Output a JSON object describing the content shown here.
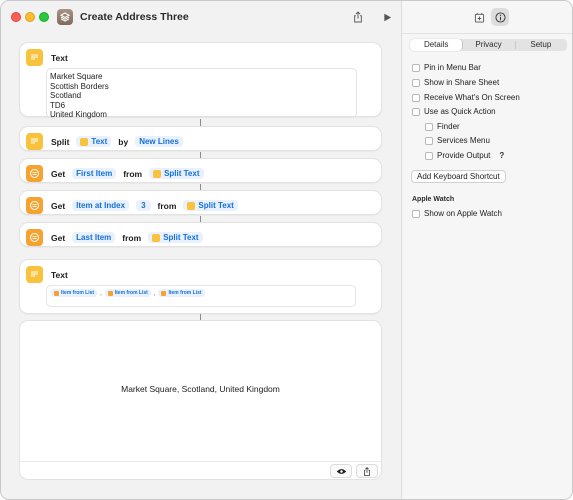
{
  "window": {
    "title": "Create Address Three",
    "app_icon": "layers-icon"
  },
  "toolbar": {
    "share_icon": "share-icon",
    "run_icon": "play-icon"
  },
  "actions": [
    {
      "kind": "text",
      "label": "Text",
      "lines": [
        "Market Square",
        "Scottish Borders",
        "Scotland",
        "TD6",
        "United Kingdom"
      ]
    },
    {
      "kind": "split",
      "label": "Split",
      "input_token": "Text",
      "by_label": "by",
      "separator_token": "New Lines"
    },
    {
      "kind": "get",
      "label": "Get",
      "item_token": "First Item",
      "from_label": "from",
      "source_token": "Split Text"
    },
    {
      "kind": "get",
      "label": "Get",
      "item_token": "Item at Index",
      "index_token": "3",
      "from_label": "from",
      "source_token": "Split Text"
    },
    {
      "kind": "get",
      "label": "Get",
      "item_token": "Last Item",
      "from_label": "from",
      "source_token": "Split Text"
    },
    {
      "kind": "text",
      "label": "Text",
      "variables": [
        "Item from List",
        "Item from List",
        "Item from List"
      ],
      "separator": ","
    }
  ],
  "result": {
    "text": "Market Square, Scotland, United Kingdom",
    "eye_icon": "eye-icon",
    "share_icon": "share-icon"
  },
  "sidebar": {
    "tabs": [
      {
        "label": "Details",
        "active": true
      },
      {
        "label": "Privacy",
        "active": false
      },
      {
        "label": "Setup",
        "active": false
      }
    ],
    "options": [
      {
        "label": "Pin in Menu Bar",
        "checked": false
      },
      {
        "label": "Show in Share Sheet",
        "checked": false
      },
      {
        "label": "Receive What's On Screen",
        "checked": false
      },
      {
        "label": "Use as Quick Action",
        "checked": false
      }
    ],
    "quick_action_options": [
      {
        "label": "Finder",
        "checked": false
      },
      {
        "label": "Services Menu",
        "checked": false
      },
      {
        "label": "Provide Output",
        "checked": false
      }
    ],
    "help_glyph": "?",
    "shortcut_button": "Add Keyboard Shortcut",
    "watch_section": "Apple Watch",
    "watch_option": {
      "label": "Show on Apple Watch",
      "checked": false
    }
  },
  "colors": {
    "token_text": "#1470d8",
    "token_bg": "#e8f1fd",
    "text_action_icon": "#f9c23c",
    "list_action_icon": "#f6a230"
  }
}
